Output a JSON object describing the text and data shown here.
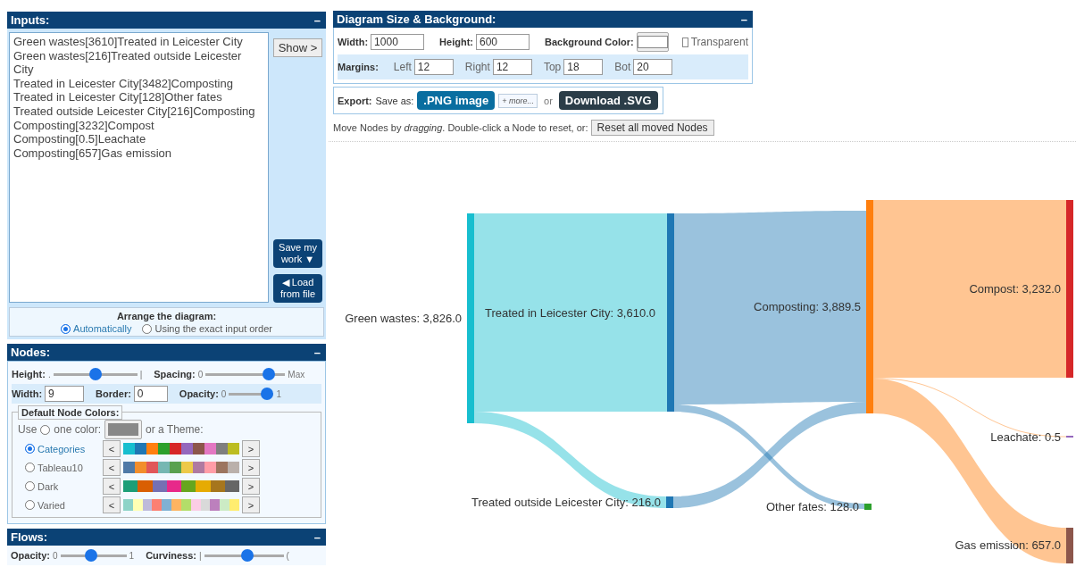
{
  "inputs": {
    "title": "Inputs:",
    "collapse": "–",
    "text": "Green wastes[3610]Treated in Leicester City\nGreen wastes[216]Treated outside Leicester City\nTreated in Leicester City[3482]Composting\nTreated in Leicester City[128]Other fates\nTreated outside Leicester City[216]Composting\nComposting[3232]Compost\nComposting[0.5]Leachate\nComposting[657]Gas emission",
    "show_button": "Show >",
    "save_button": "Save my work ▼",
    "load_button": "◀ Load from file",
    "arrange": {
      "title": "Arrange the diagram:",
      "options": [
        {
          "label": "Automatically",
          "selected": true
        },
        {
          "label": "Using the exact input order",
          "selected": false
        }
      ]
    }
  },
  "nodes_panel": {
    "title": "Nodes:",
    "collapse": "–",
    "height": {
      "label": "Height:",
      "min": ".",
      "max": "|",
      "level": 0.5
    },
    "spacing": {
      "label": "Spacing:",
      "min": "0",
      "max": "Max",
      "level": 0.85
    },
    "width": {
      "label": "Width:",
      "value": "9"
    },
    "border": {
      "label": "Border:",
      "value": "0"
    },
    "opacity": {
      "label": "Opacity:",
      "min": "0",
      "max": "1",
      "level": 1
    },
    "colors": {
      "legend": "Default Node Colors:",
      "use": "Use",
      "one_color": {
        "label": "one color:",
        "selected": false
      },
      "swatch": {
        "color": "#888888"
      },
      "theme_text": "or a Theme:",
      "themes": [
        {
          "label": "Categories",
          "selected": true,
          "prev": "<",
          "next": ">",
          "colors": [
            {
              "color": "#17becf"
            },
            {
              "color": "#1f77b4"
            },
            {
              "color": "#ff7f0e"
            },
            {
              "color": "#2ca02c"
            },
            {
              "color": "#d62728"
            },
            {
              "color": "#9467bd"
            },
            {
              "color": "#8c564b"
            },
            {
              "color": "#e377c2"
            },
            {
              "color": "#7f7f7f"
            },
            {
              "color": "#bcbd22"
            }
          ]
        },
        {
          "label": "Tableau10",
          "selected": false,
          "prev": "<",
          "next": ">",
          "colors": [
            {
              "color": "#4e79a7"
            },
            {
              "color": "#f28e2c"
            },
            {
              "color": "#e15759"
            },
            {
              "color": "#76b7b2"
            },
            {
              "color": "#59a14f"
            },
            {
              "color": "#edc949"
            },
            {
              "color": "#af7aa1"
            },
            {
              "color": "#ff9da7"
            },
            {
              "color": "#9c755f"
            },
            {
              "color": "#bab0ab"
            }
          ]
        },
        {
          "label": "Dark",
          "selected": false,
          "prev": "<",
          "next": ">",
          "colors": [
            {
              "color": "#1b9e77"
            },
            {
              "color": "#d95f02"
            },
            {
              "color": "#7570b3"
            },
            {
              "color": "#e7298a"
            },
            {
              "color": "#66a61e"
            },
            {
              "color": "#e6ab02"
            },
            {
              "color": "#a6761d"
            },
            {
              "color": "#666666"
            }
          ]
        },
        {
          "label": "Varied",
          "selected": false,
          "prev": "<",
          "next": ">",
          "colors": [
            {
              "color": "#8dd3c7"
            },
            {
              "color": "#ffffb3"
            },
            {
              "color": "#bebada"
            },
            {
              "color": "#fb8072"
            },
            {
              "color": "#80b1d3"
            },
            {
              "color": "#fdb462"
            },
            {
              "color": "#b3de69"
            },
            {
              "color": "#fccde5"
            },
            {
              "color": "#d9d9d9"
            },
            {
              "color": "#bc80bd"
            },
            {
              "color": "#ccebc5"
            },
            {
              "color": "#ffed6f"
            }
          ]
        }
      ]
    }
  },
  "flows_panel": {
    "title": "Flows:",
    "collapse": "–",
    "opacity": {
      "label": "Opacity:",
      "min": "0",
      "max": "1",
      "level": 0.45
    },
    "curviness": {
      "label": "Curviness:",
      "min": "|",
      "max": "(",
      "level": 0.55
    }
  },
  "size_panel": {
    "title": "Diagram Size & Background:",
    "collapse": "–",
    "width": {
      "label": "Width:",
      "value": "1000"
    },
    "height": {
      "label": "Height:",
      "value": "600"
    },
    "background": {
      "label": "Background Color:",
      "color": "#ffffff"
    },
    "transparent": {
      "label": "Transparent",
      "checked": false
    },
    "margins": {
      "label": "Margins:",
      "fields": [
        {
          "label": "Left",
          "value": "12"
        },
        {
          "label": "Right",
          "value": "12"
        },
        {
          "label": "Top",
          "value": "18"
        },
        {
          "label": "Bot",
          "value": "20"
        }
      ]
    }
  },
  "export": {
    "label": "Export:",
    "save_as": "Save as:",
    "png_button": ".PNG image",
    "more_button": "+ more...",
    "or": "or",
    "svg_button": "Download .SVG"
  },
  "move_hint": "Move Nodes by *dragging*. Double-click a Node to reset, or:",
  "reset_button": "Reset all moved Nodes",
  "diagram": {
    "nodes": [
      {
        "label": "Green wastes: 3,826.0",
        "color": "#17becf"
      },
      {
        "label": "Treated in Leicester City: 3,610.0",
        "color": "#1f77b4"
      },
      {
        "label": "Treated outside Leicester City: 216.0",
        "color": "#1f77b4"
      },
      {
        "label": "Composting: 3,889.5",
        "color": "#ff7f0e"
      },
      {
        "label": "Other fates: 128.0",
        "color": "#2ca02c"
      },
      {
        "label": "Compost: 3,232.0",
        "color": "#d62728"
      },
      {
        "label": "Leachate: 0.5",
        "color": "#9467bd"
      },
      {
        "label": "Gas emission: 657.0",
        "color": "#8c564b"
      }
    ]
  }
}
